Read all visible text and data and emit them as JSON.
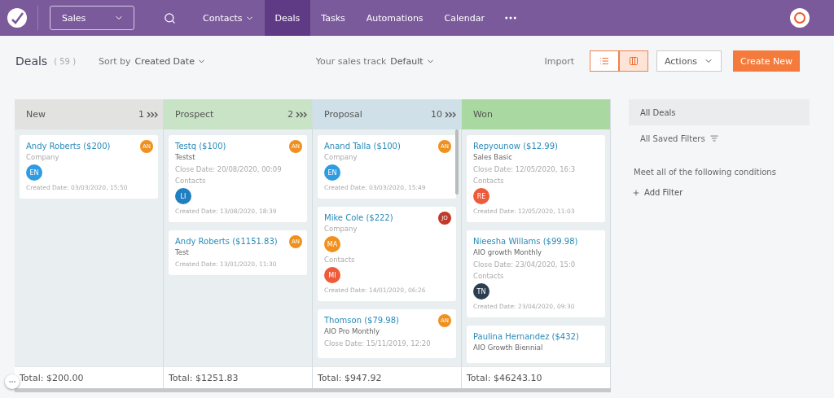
{
  "topbar": {
    "module": "Sales",
    "nav": [
      {
        "label": "Contacts",
        "selected": false,
        "dropdown": true
      },
      {
        "label": "Deals",
        "selected": true,
        "dropdown": false
      },
      {
        "label": "Tasks",
        "selected": false,
        "dropdown": false
      },
      {
        "label": "Automations",
        "selected": false,
        "dropdown": false
      },
      {
        "label": "Calendar",
        "selected": false,
        "dropdown": false
      }
    ]
  },
  "header": {
    "title": "Deals",
    "count": "( 59 )",
    "sort_label": "Sort by",
    "sort_value": "Created Date",
    "track_label": "Your sales track",
    "track_value": "Default",
    "import": "Import",
    "views": [
      {
        "kind": "list",
        "selected": false
      },
      {
        "kind": "board",
        "selected": true
      }
    ],
    "actions": "Actions",
    "create": "Create New"
  },
  "columns": [
    {
      "name": "New",
      "count": "1",
      "color": "#e2e2e0",
      "total": "Total: $200.00",
      "cards": [
        {
          "title": "Andy Roberts ($200)",
          "owner": {
            "initials": "AN",
            "color": "#f0901e"
          },
          "lines": [
            {
              "kind": "label",
              "text": "Company"
            },
            {
              "kind": "avatar",
              "text": "EN",
              "color": "#2f9be0"
            },
            {
              "kind": "created",
              "text": "Created Date: 03/03/2020, 15:50"
            }
          ]
        }
      ]
    },
    {
      "name": "Prospect",
      "count": "2",
      "color": "#c9e3c6",
      "total": "Total: $1251.83",
      "cards": [
        {
          "title": "Testq ($100)",
          "owner": {
            "initials": "AN",
            "color": "#f0901e"
          },
          "lines": [
            {
              "kind": "subtitle",
              "text": "Testst"
            },
            {
              "kind": "label",
              "text": "Close Date: 20/08/2020, 00:09"
            },
            {
              "kind": "label",
              "text": "Contacts"
            },
            {
              "kind": "avatar",
              "text": "LI",
              "color": "#1f7fc0"
            },
            {
              "kind": "created",
              "text": "Created Date: 13/08/2020, 18:39"
            }
          ]
        },
        {
          "title": "Andy Roberts ($1151.83)",
          "owner": {
            "initials": "AN",
            "color": "#f0901e"
          },
          "lines": [
            {
              "kind": "subtitle",
              "text": "Test"
            },
            {
              "kind": "created",
              "text": "Created Date: 13/01/2020, 11:30"
            }
          ]
        }
      ]
    },
    {
      "name": "Proposal",
      "count": "10",
      "color": "#cfe0e8",
      "total": "Total: $947.92",
      "scroll": true,
      "cards": [
        {
          "title": "Anand Talla ($100)",
          "owner": {
            "initials": "AN",
            "color": "#f0901e"
          },
          "lines": [
            {
              "kind": "label",
              "text": "Company"
            },
            {
              "kind": "avatar",
              "text": "EN",
              "color": "#2f9be0"
            },
            {
              "kind": "created",
              "text": "Created Date: 03/03/2020, 15:49"
            }
          ]
        },
        {
          "title": "Mike Cole ($222)",
          "owner": {
            "initials": "JO",
            "color": "#c0392b"
          },
          "lines": [
            {
              "kind": "label",
              "text": "Company"
            },
            {
              "kind": "avatar",
              "text": "MA",
              "color": "#f0901e"
            },
            {
              "kind": "label",
              "text": "Contacts"
            },
            {
              "kind": "avatar",
              "text": "MI",
              "color": "#ee5a3a"
            },
            {
              "kind": "created",
              "text": "Created Date: 14/01/2020, 06:26"
            }
          ]
        },
        {
          "title": "Thomson ($79.98)",
          "owner": {
            "initials": "AN",
            "color": "#f0901e"
          },
          "lines": [
            {
              "kind": "subtitle",
              "text": "AIO Pro Monthly"
            },
            {
              "kind": "label",
              "text": "Close Date: 15/11/2019, 12:20"
            }
          ]
        }
      ]
    },
    {
      "name": "Won",
      "color": "#a9d8a0",
      "total": "Total: $46243.10",
      "cards": [
        {
          "title": "Repyounow ($12.99)",
          "lines": [
            {
              "kind": "subtitle",
              "text": "Sales Basic"
            },
            {
              "kind": "label",
              "text": "Close Date: 12/05/2020, 16:3"
            },
            {
              "kind": "label",
              "text": "Contacts"
            },
            {
              "kind": "avatar",
              "text": "RE",
              "color": "#ee5a3a"
            },
            {
              "kind": "created",
              "text": "Created Date: 12/05/2020, 11:03"
            }
          ]
        },
        {
          "title": "Nieesha Willams ($99.98)",
          "lines": [
            {
              "kind": "subtitle",
              "text": "AIO growth Monthly"
            },
            {
              "kind": "label",
              "text": "Close Date: 23/04/2020, 15:0"
            },
            {
              "kind": "label",
              "text": "Contacts"
            },
            {
              "kind": "avatar",
              "text": "TN",
              "color": "#2c3e50"
            },
            {
              "kind": "created",
              "text": "Created Date: 23/04/2020, 09:30"
            }
          ]
        },
        {
          "title": "Paulina Hernandez ($432)",
          "lines": [
            {
              "kind": "subtitle",
              "text": "AIO Growth Biennial"
            }
          ]
        }
      ]
    }
  ],
  "filters": {
    "items": [
      {
        "label": "All Deals",
        "selected": true,
        "icon": false
      },
      {
        "label": "All Saved Filters",
        "selected": false,
        "icon": true
      }
    ],
    "conditions": "Meet all of the following conditions",
    "add": "Add Filter"
  }
}
